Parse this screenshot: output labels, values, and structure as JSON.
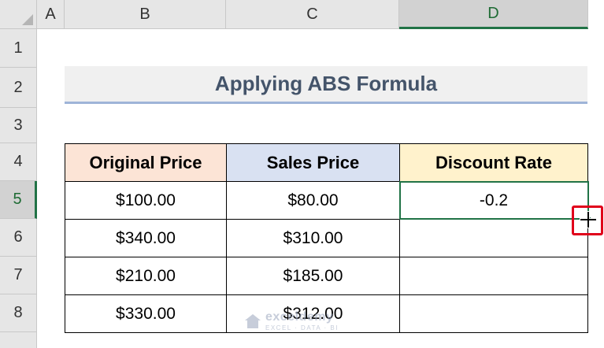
{
  "columns": [
    "A",
    "B",
    "C",
    "D"
  ],
  "rows": [
    "1",
    "2",
    "3",
    "4",
    "5",
    "6",
    "7",
    "8"
  ],
  "title": "Applying ABS Formula",
  "table": {
    "headers": [
      "Original Price",
      "Sales Price",
      "Discount Rate"
    ],
    "rows": [
      [
        "$100.00",
        "$80.00",
        "-0.2"
      ],
      [
        "$340.00",
        "$310.00",
        ""
      ],
      [
        "$210.00",
        "$185.00",
        ""
      ],
      [
        "$330.00",
        "$312.00",
        ""
      ]
    ]
  },
  "selection": {
    "column": "D",
    "row": "5"
  },
  "watermark": {
    "brand": "exceldemy",
    "tagline": "EXCEL · DATA · BI"
  },
  "colors": {
    "accent": "#217346",
    "callout": "#e0001b",
    "title_text": "#44546a",
    "header_original": "#fce4d6",
    "header_sales": "#d9e1f2",
    "header_discount": "#fff2cc"
  },
  "icons": {
    "fill_handle_cursor": "plus-cursor-icon",
    "watermark_logo": "house-logo-icon"
  }
}
